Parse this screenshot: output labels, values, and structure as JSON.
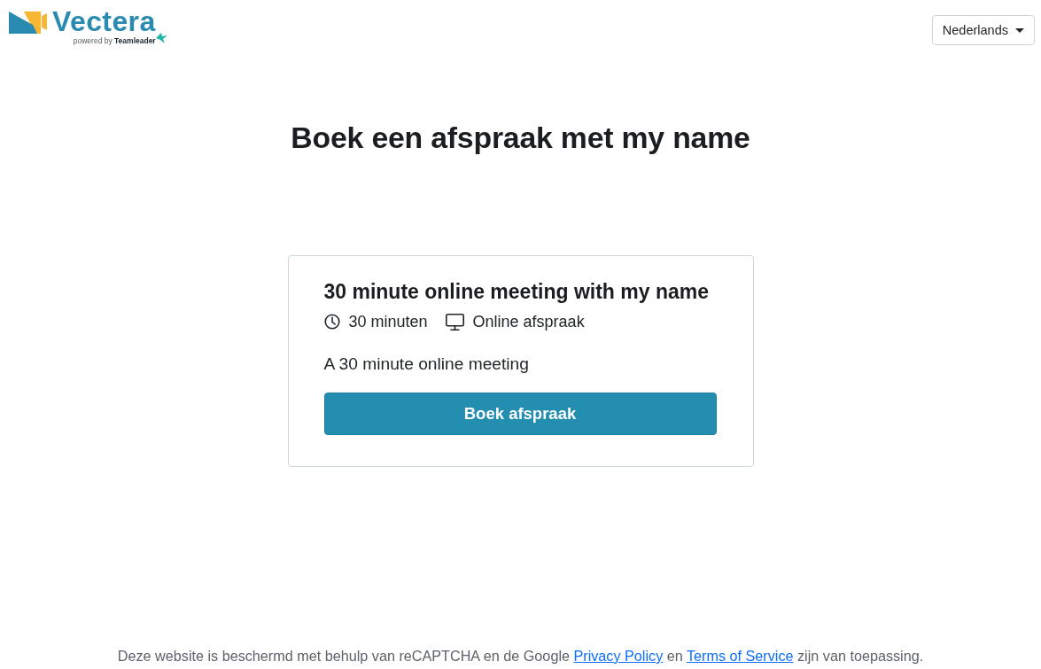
{
  "header": {
    "logo": {
      "name": "Vectera",
      "tagline": "powered by **Teamleader**"
    },
    "language_selector": {
      "value": "Nederlands"
    }
  },
  "title": "Boek een afspraak met my name",
  "event_card": {
    "title": "30 minute online meeting with my name",
    "details": [
      {
        "kind": "duration",
        "text": "30 minuten"
      },
      {
        "kind": "location",
        "text": "Online afspraak"
      }
    ],
    "description": "A 30 minute online meeting",
    "button": "Boek afspraak"
  },
  "footer": {
    "segments": [
      {
        "kind": "text",
        "text": "Deze website is beschermd met behulp van reCAPTCHA en de Google "
      },
      {
        "kind": "link",
        "text": "Privacy Policy"
      },
      {
        "kind": "text",
        "text": " en "
      },
      {
        "kind": "link",
        "text": "Terms of Service"
      },
      {
        "kind": "text",
        "text": " zijn van toepassing."
      }
    ]
  }
}
